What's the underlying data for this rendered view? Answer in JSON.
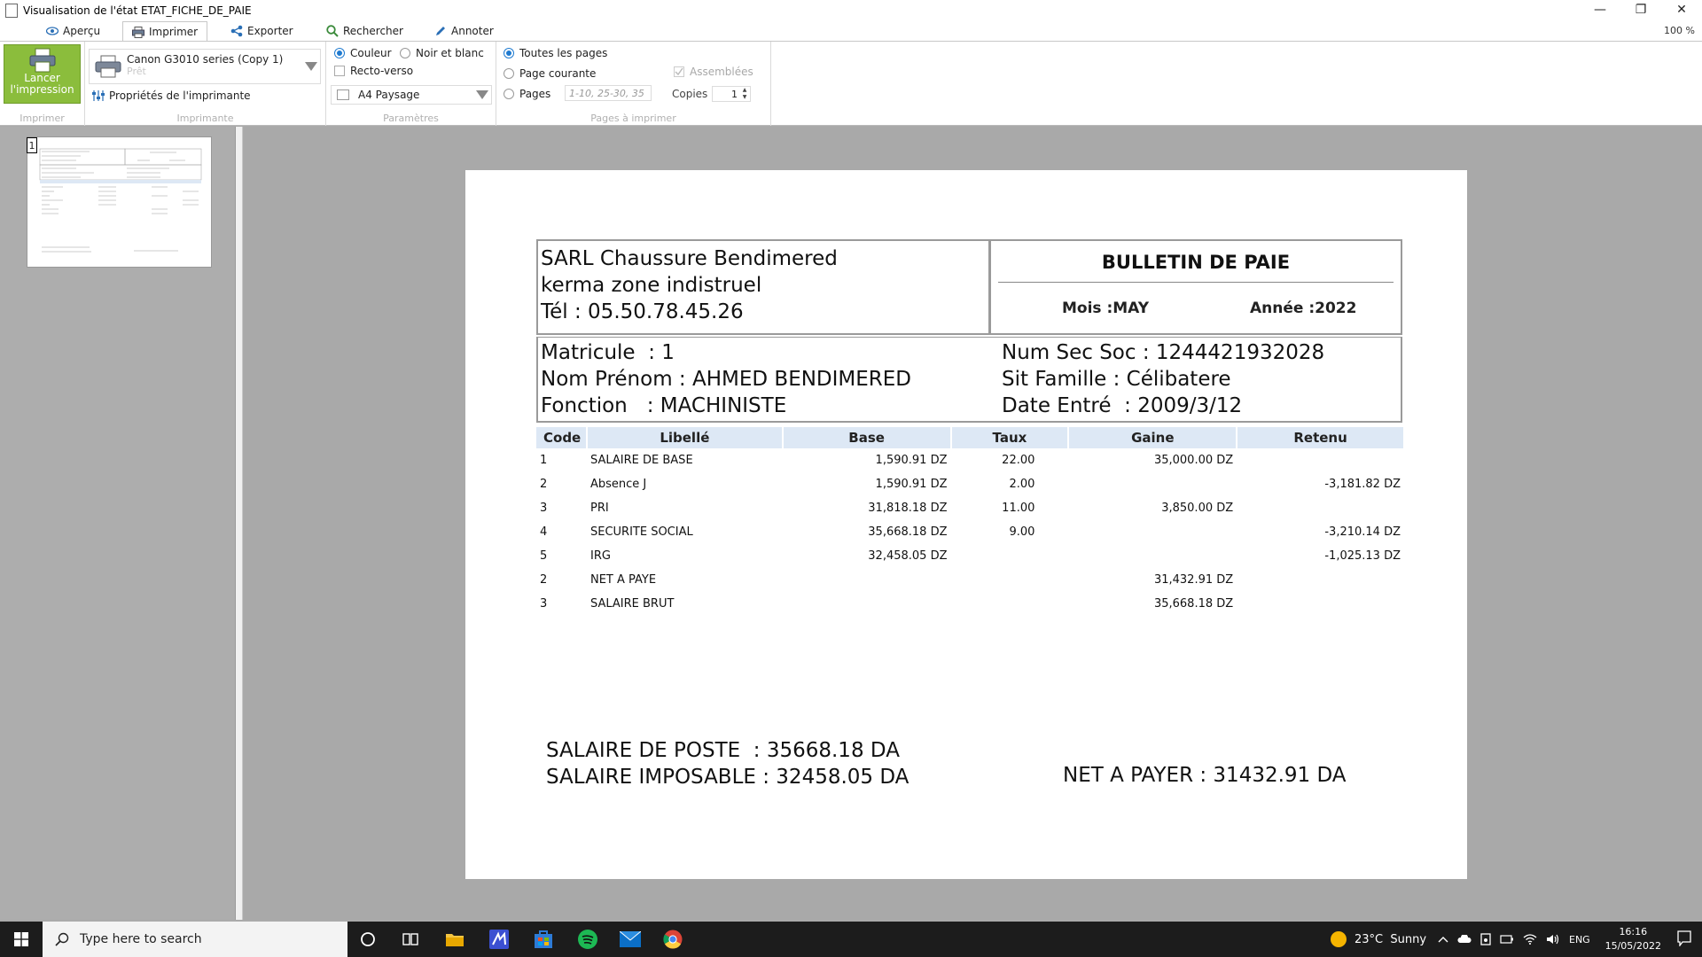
{
  "window": {
    "title": "Visualisation de l'état ETAT_FICHE_DE_PAIE",
    "controls": [
      "—",
      "❐",
      "✕"
    ]
  },
  "tabs": [
    {
      "label": "Aperçu",
      "icon": "eye-icon"
    },
    {
      "label": "Imprimer",
      "icon": "printer-icon"
    },
    {
      "label": "Exporter",
      "icon": "share-icon"
    },
    {
      "label": "Rechercher",
      "icon": "search-icon"
    },
    {
      "label": "Annoter",
      "icon": "pen-icon"
    }
  ],
  "zoom": "100 %",
  "ribbon": {
    "print_button": "Lancer l'impression",
    "groups": {
      "imprimer": "Imprimer",
      "imprimante": "Imprimante",
      "parametres": "Paramètres",
      "pages": "Pages à imprimer"
    },
    "printer_name": "Canon G3010 series (Copy 1)",
    "printer_status": "Prêt",
    "printer_properties": "Propriétés de l'imprimante",
    "color_option": "Couleur",
    "bw_option": "Noir et blanc",
    "duplex_option": "Recto-verso",
    "paper": "A4 Paysage",
    "all_pages": "Toutes les pages",
    "current_page": "Page courante",
    "pages_option": "Pages",
    "pages_placeholder": "1-10, 25-30, 35",
    "copies_label": "Copies",
    "copies_value": "1",
    "collate_option": "Assemblées"
  },
  "thumbnail": {
    "page_number": "1"
  },
  "document": {
    "company": {
      "name": "SARL Chaussure Bendimered",
      "address": "kerma zone indistruel",
      "phone": "Tél : 05.50.78.45.26"
    },
    "title": "BULLETIN DE PAIE",
    "mois": "Mois :MAY",
    "annee": "Année :2022",
    "employee": {
      "matricule": "Matricule  : 1",
      "nom": "Nom Prénom : AHMED BENDIMERED",
      "fonction": "Fonction   : MACHINISTE",
      "secsoc": "Num Sec Soc : 1244421932028",
      "famille": "Sit Famille : Célibatere",
      "entree": "Date Entré  : 2009/3/12"
    },
    "table": {
      "headers": [
        "Code",
        "Libellé",
        "Base",
        "Taux",
        "Gaine",
        "Retenu"
      ],
      "rows": [
        [
          "1",
          "SALAIRE DE BASE",
          "1,590.91 DZ",
          "22.00",
          "35,000.00 DZ",
          ""
        ],
        [
          "2",
          "Absence J",
          "1,590.91 DZ",
          "2.00",
          "",
          "-3,181.82 DZ"
        ],
        [
          "3",
          "PRI",
          "31,818.18 DZ",
          "11.00",
          "3,850.00 DZ",
          ""
        ],
        [
          "4",
          "SECURITE SOCIAL",
          "35,668.18 DZ",
          "9.00",
          "",
          "-3,210.14 DZ"
        ],
        [
          "5",
          "IRG",
          "32,458.05 DZ",
          "",
          "",
          "-1,025.13 DZ"
        ],
        [
          "2",
          "NET A PAYE",
          "",
          "",
          "31,432.91 DZ",
          ""
        ],
        [
          "3",
          "SALAIRE BRUT",
          "",
          "",
          "35,668.18 DZ",
          ""
        ]
      ]
    },
    "footer": {
      "salaire_poste": "SALAIRE DE POSTE  : 35668.18 DA",
      "salaire_imposable": "SALAIRE IMPOSABLE : 32458.05 DA",
      "net_payer": "NET A PAYER : 31432.91 DA"
    }
  },
  "taskbar": {
    "search_placeholder": "Type here to search",
    "weather": "23°C  Sunny",
    "language": "ENG",
    "time": "16:16",
    "date": "15/05/2022"
  },
  "colors": {
    "print_button": "#8bbd3c",
    "table_header": "#dde8f5",
    "accent": "#1e7ad0"
  }
}
